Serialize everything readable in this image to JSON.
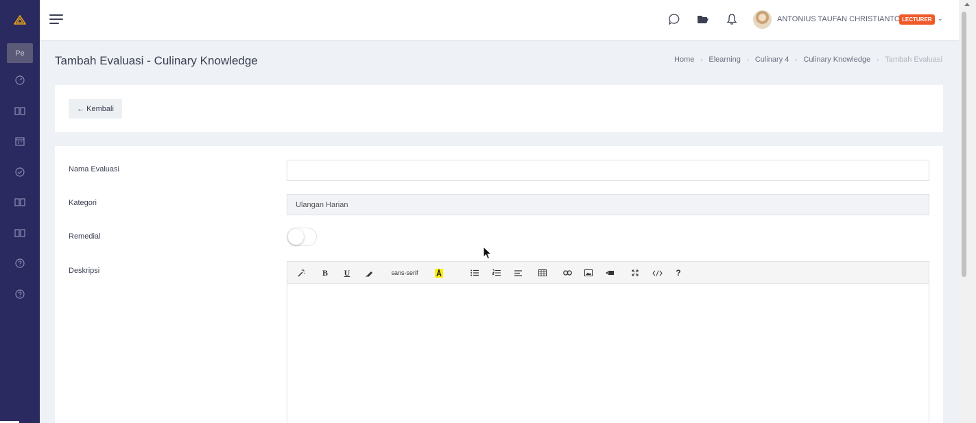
{
  "header": {
    "user_name": "ANTONIUS TAUFAN CHRISTIANTO",
    "role_badge": "LECTURER"
  },
  "sidebar": {
    "collapsed_label": "Pe",
    "items": [
      {
        "icon": "dashboard-icon"
      },
      {
        "icon": "book-icon"
      },
      {
        "icon": "calendar-icon"
      },
      {
        "icon": "check-circle-icon"
      },
      {
        "icon": "book-icon"
      },
      {
        "icon": "book-icon"
      },
      {
        "icon": "help-icon"
      },
      {
        "icon": "help-icon"
      }
    ]
  },
  "page": {
    "title": "Tambah Evaluasi - Culinary Knowledge",
    "breadcrumb": [
      "Home",
      "Elearning",
      "Culinary 4",
      "Culinary Knowledge",
      "Tambah Evaluasi"
    ]
  },
  "back_button": "← Kembali",
  "form": {
    "nama_label": "Nama Evaluasi",
    "nama_value": "",
    "kategori_label": "Kategori",
    "kategori_value": "Ulangan Harian",
    "remedial_label": "Remedial",
    "remedial_on": false,
    "deskripsi_label": "Deskripsi",
    "font_name": "sans-serif",
    "help_label": "?"
  },
  "colors": {
    "sidebar": "#2a2960",
    "badge": "#f05a28",
    "background": "#eef1f5"
  }
}
